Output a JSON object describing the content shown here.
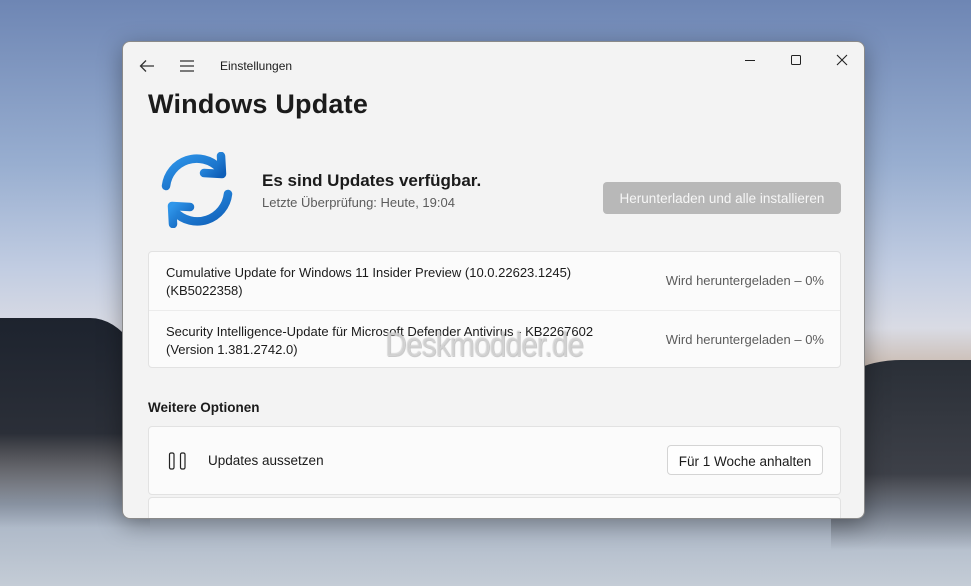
{
  "window": {
    "title": "Einstellungen",
    "page_title": "Windows Update"
  },
  "status": {
    "headline": "Es sind Updates verfügbar.",
    "last_check": "Letzte Überprüfung: Heute, 19:04",
    "download_button": "Herunterladen und alle installieren"
  },
  "updates": [
    {
      "name_line1": "Cumulative Update for Windows 11 Insider Preview (10.0.22623.1245)",
      "name_line2": "(KB5022358)",
      "status": "Wird heruntergeladen – 0%",
      "progress_percent": 0
    },
    {
      "name_line1": "Security Intelligence-Update für Microsoft Defender Antivirus - KB2267602",
      "name_line2": "(Version 1.381.2742.0)",
      "status": "Wird heruntergeladen – 0%",
      "progress_percent": 0
    }
  ],
  "more_options": {
    "title": "Weitere Optionen",
    "pause": {
      "label": "Updates aussetzen",
      "button": "Für 1 Woche anhalten"
    }
  },
  "watermark": "Deskmodder.de",
  "icons": {
    "back": "back-arrow-icon",
    "menu": "hamburger-menu-icon",
    "minimize": "minimize-icon",
    "maximize": "maximize-icon",
    "close": "close-icon",
    "sync": "sync-icon",
    "pause": "pause-icon"
  },
  "colors": {
    "accent_blue": "#1c7fd6",
    "disabled_button": "#b8b8b8"
  }
}
